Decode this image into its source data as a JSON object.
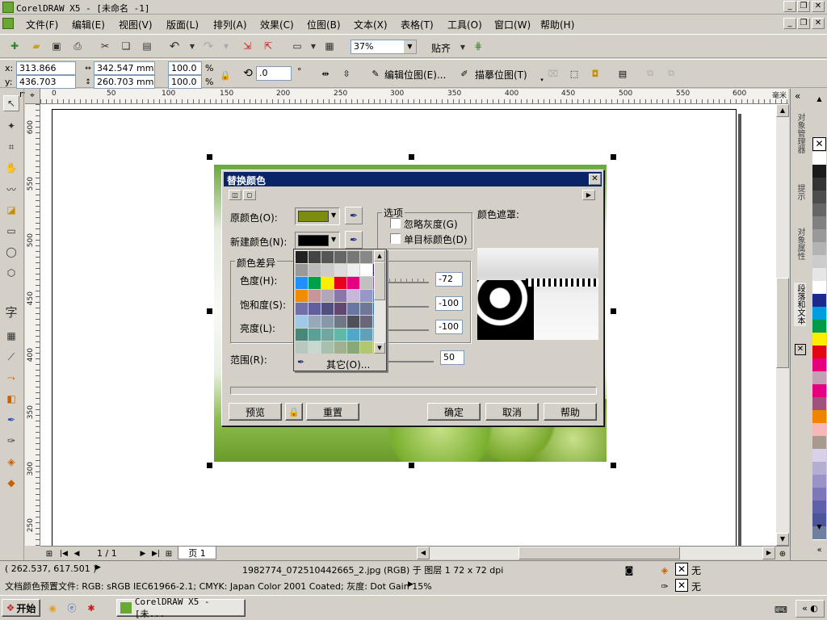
{
  "app": {
    "title": "CorelDRAW X5 - [未命名 -1]",
    "menu": [
      "文件(F)",
      "编辑(E)",
      "视图(V)",
      "版面(L)",
      "排列(A)",
      "效果(C)",
      "位图(B)",
      "文本(X)",
      "表格(T)",
      "工具(O)",
      "窗口(W)",
      "帮助(H)"
    ]
  },
  "toolbar": {
    "zoom": "37%",
    "snap_label": "贴齐"
  },
  "propbar": {
    "x_label": "x:",
    "x": "313.866 mm",
    "y_label": "y:",
    "y": "436.703 mm",
    "w": "342.547 mm",
    "h": "260.703 mm",
    "scale_w": "100.0",
    "scale_h": "100.0",
    "pct": "%",
    "angle": ".0",
    "deg": "°",
    "edit_bitmap": "编辑位图(E)...",
    "trace_bitmap": "描摹位图(T)"
  },
  "ruler": {
    "unit": "毫米",
    "h_ticks": [
      "0",
      "50",
      "100",
      "150",
      "200",
      "250",
      "300",
      "350",
      "400",
      "450",
      "500",
      "550",
      "600"
    ],
    "v_ticks": [
      "600",
      "550",
      "500",
      "450",
      "400",
      "350",
      "300",
      "250"
    ]
  },
  "dialog": {
    "title": "替换颜色",
    "orig_label": "原颜色(O):",
    "new_label": "新建颜色(N):",
    "options_group": "选项",
    "ignore_gray": "忽略灰度(G)",
    "single_target": "单目标颜色(D)",
    "mask_label": "颜色遮罩:",
    "diff_group": "颜色差异",
    "hue_label": "色度(H):",
    "sat_label": "饱和度(S):",
    "light_label": "亮度(L):",
    "hue_value": "-72",
    "sat_value": "-100",
    "light_value": "-100",
    "range_label": "范围(R):",
    "range_value": "50",
    "preview": "预览",
    "reset": "重置",
    "ok": "确定",
    "cancel": "取消",
    "help": "帮助",
    "other_colors": "其它(O)..."
  },
  "colors": {
    "original": "#7b8c0e",
    "new": "#000000",
    "grid": [
      "#222222",
      "#444444",
      "#555555",
      "#666666",
      "#777777",
      "#888888",
      "#aaaaaa",
      "#999999",
      "#bbbbbb",
      "#cccccc",
      "#dddddd",
      "#eeeeee",
      "#ffffff",
      "#222288",
      "#1e90ff",
      "#00a04a",
      "#ffee00",
      "#e8001e",
      "#e4007f",
      "#c0c0c0",
      "#8b5aa8",
      "#f08c00",
      "#c89696",
      "#b0a8b8",
      "#8878a8",
      "#c8b8d8",
      "#9898c8",
      "#4878c8",
      "#7070a8",
      "#6060a0",
      "#505080",
      "#604870",
      "#6878a0",
      "#707898",
      "#3870a8",
      "#a0c8e8",
      "#98a8b8",
      "#8898a8",
      "#707888",
      "#505058",
      "#686878",
      "#5890a8",
      "#488878",
      "#58a098",
      "#70a8a0",
      "#60b8a8",
      "#50a8c8",
      "#60a0b8",
      "#98b0b8",
      "#b8c8c0",
      "#c8d8d0",
      "#a8c0b0",
      "#a0b090",
      "#88a878",
      "#b0c870",
      "#c0c070"
    ],
    "palette": [
      "#ffffff",
      "#1a1a1a",
      "#333333",
      "#4d4d4d",
      "#666666",
      "#808080",
      "#999999",
      "#b3b3b3",
      "#cccccc",
      "#e6e6e6",
      "#ffffff",
      "#1c2a8c",
      "#009ee0",
      "#009a48",
      "#ffed00",
      "#e30613",
      "#e6007e",
      "#c3a0b4",
      "#e4007f",
      "#a0527f",
      "#f08300",
      "#f5b7b7",
      "#a89a8e",
      "#d9d0ea",
      "#b4aed2",
      "#9a93c7",
      "#7c77b9",
      "#5e60a8",
      "#4b5597",
      "#6e7f9f"
    ]
  },
  "docker": {
    "tab_object_manager": "对象管理器",
    "tab_hints": "提示",
    "tab_object_props": "对象属性",
    "tab_para_text": "段落和文本"
  },
  "nav": {
    "page_count": "1 / 1",
    "page_tab": "页 1"
  },
  "status": {
    "coords": "( 262.537, 617.501 )",
    "object_info": "1982774_072510442665_2.jpg (RGB) 于 图层 1 72 x 72 dpi",
    "color_profile": "文档颜色预置文件: RGB: sRGB IEC61966-2.1; CMYK: Japan Color 2001 Coated; 灰度: Dot Gain 15%",
    "fill_none": "无",
    "outline_none": "无"
  },
  "taskbar": {
    "start": "开始",
    "window": "CorelDRAW X5 - [未..."
  }
}
